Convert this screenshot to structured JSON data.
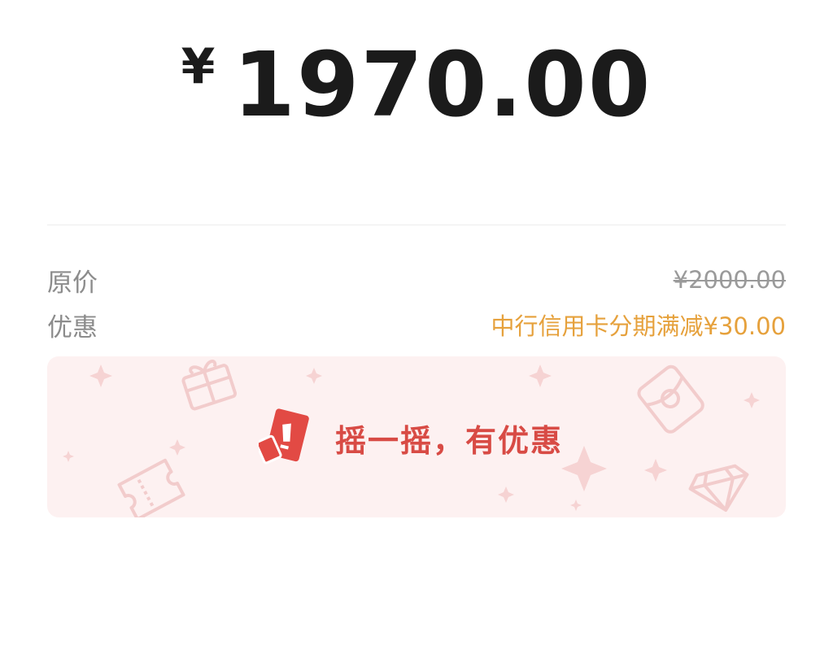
{
  "payment": {
    "currency_symbol": "¥",
    "amount": "1970.00"
  },
  "details": {
    "original_price_label": "原价",
    "original_price_value": "¥2000.00",
    "discount_label": "优惠",
    "discount_value": "中行信用卡分期满减¥30.00"
  },
  "shake_banner": {
    "text": "摇一摇，有优惠",
    "icon": "shake-coupon-icon",
    "accent_color": "#d84b45",
    "background_color": "#fdf1f1"
  },
  "colors": {
    "discount_text": "#e6a13c",
    "amount_text": "#1b1b1b",
    "label_text": "#8c8c8c"
  }
}
